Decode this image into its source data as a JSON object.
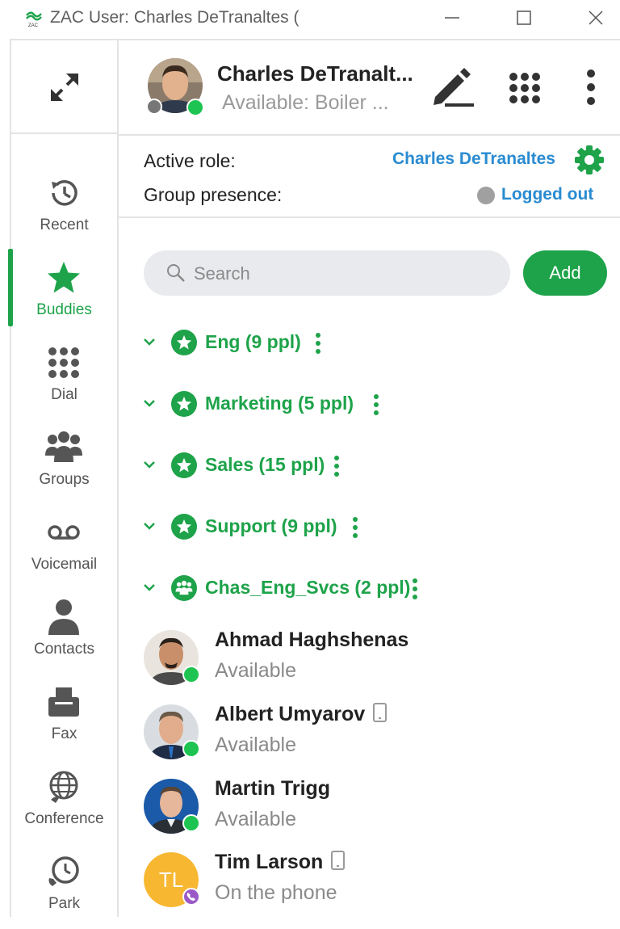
{
  "window": {
    "title": "ZAC User: Charles DeTranaltes (",
    "app_icon": "zac-logo-icon",
    "controls": [
      "minimize-icon",
      "maximize-icon",
      "close-icon"
    ]
  },
  "header": {
    "user_name": "Charles DeTranalt...",
    "user_status": "Available: Boiler ...",
    "presence": "available",
    "icons": [
      "pencil-icon",
      "dialpad-icon",
      "more-vertical-icon"
    ]
  },
  "role": {
    "active_role_label": "Active role:",
    "active_role_value": "Charles DeTranaltes",
    "group_presence_label": "Group presence:",
    "group_presence_value": "Logged out"
  },
  "sidebar": {
    "expand_icon": "expand-icon",
    "items": [
      {
        "label": "Recent",
        "icon": "history-icon",
        "active": false
      },
      {
        "label": "Buddies",
        "icon": "star-icon",
        "active": true
      },
      {
        "label": "Dial",
        "icon": "dialpad-icon",
        "active": false
      },
      {
        "label": "Groups",
        "icon": "people-icon",
        "active": false
      },
      {
        "label": "Voicemail",
        "icon": "voicemail-icon",
        "active": false
      },
      {
        "label": "Contacts",
        "icon": "person-icon",
        "active": false
      },
      {
        "label": "Fax",
        "icon": "fax-icon",
        "active": false
      },
      {
        "label": "Conference",
        "icon": "globe-icon",
        "active": false
      },
      {
        "label": "Park",
        "icon": "phone-clock-icon",
        "active": false
      }
    ]
  },
  "search": {
    "placeholder": "Search",
    "add_label": "Add"
  },
  "groups": [
    {
      "name": "Eng (9 ppl)",
      "type": "star"
    },
    {
      "name": "Marketing (5 ppl)",
      "type": "star"
    },
    {
      "name": "Sales (15 ppl)",
      "type": "star"
    },
    {
      "name": "Support (9 ppl)",
      "type": "star"
    },
    {
      "name": "Chas_Eng_Svcs (2 ppl)",
      "type": "people"
    }
  ],
  "buddies": [
    {
      "name": "Ahmad Haghshenas",
      "status": "Available",
      "presence": "available",
      "mobile": false
    },
    {
      "name": "Albert Umyarov",
      "status": "Available",
      "presence": "available",
      "mobile": true
    },
    {
      "name": "Martin Trigg",
      "status": "Available",
      "presence": "available",
      "mobile": false
    },
    {
      "name": "Tim Larson",
      "status": "On the phone",
      "presence": "on-phone",
      "mobile": true,
      "initials": "TL"
    }
  ],
  "colors": {
    "accent_green": "#1ea34a",
    "presence_green": "#1ec451",
    "link_blue": "#2a8bd1",
    "phone_purple": "#9b59c8",
    "initials_bg": "#f7b731"
  }
}
